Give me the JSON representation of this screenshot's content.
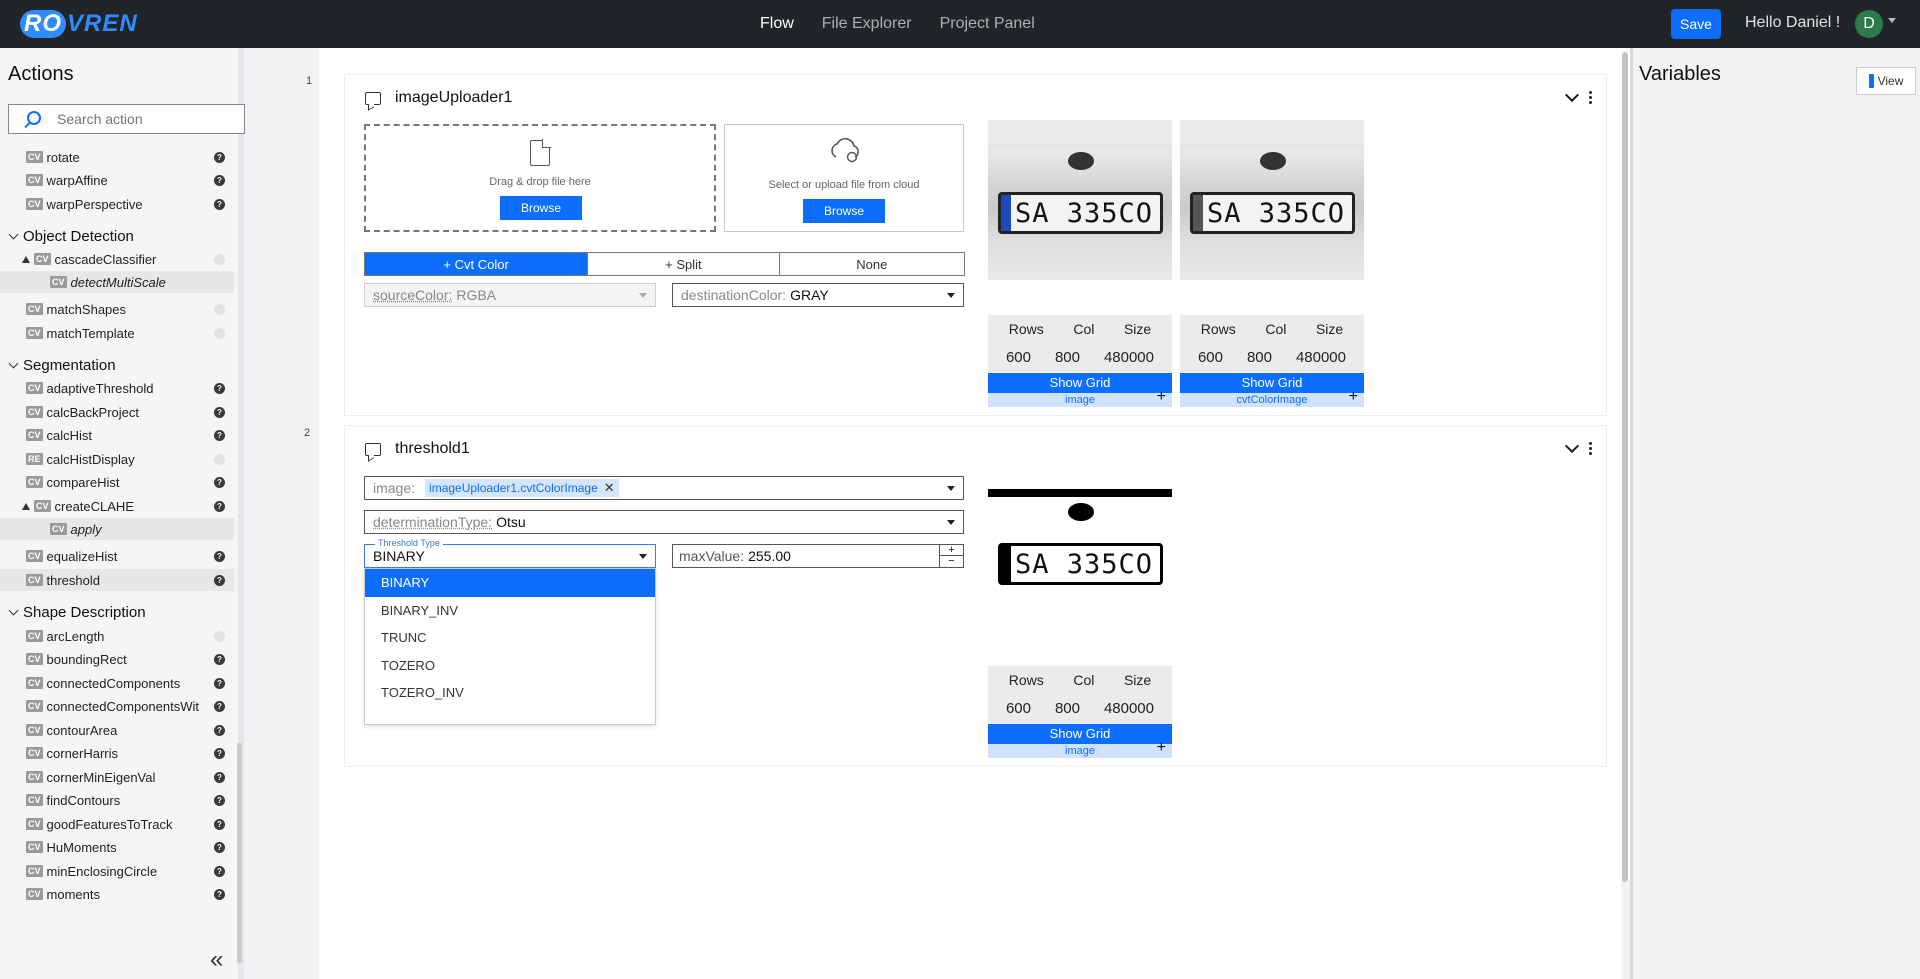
{
  "app": {
    "logo": "ROVREN",
    "logo_ro": "RO",
    "logo_rest": "VREN"
  },
  "nav": {
    "items": [
      "Flow",
      "File Explorer",
      "Project Panel"
    ],
    "active": "Flow"
  },
  "header": {
    "save_label": "Save",
    "greeting": "Hello Daniel !",
    "avatar_initial": "D"
  },
  "sidebar": {
    "title": "Actions",
    "search_placeholder": "Search action",
    "items": [
      {
        "type": "item",
        "tag": "CV",
        "label": "rotate",
        "help": true
      },
      {
        "type": "item",
        "tag": "CV",
        "label": "warpAffine",
        "help": true
      },
      {
        "type": "item",
        "tag": "CV",
        "label": "warpPerspective",
        "help": true
      },
      {
        "type": "group",
        "label": "Object Detection"
      },
      {
        "type": "item",
        "tag": "CV",
        "label": "cascadeClassifier",
        "help": false,
        "expanded": true
      },
      {
        "type": "child",
        "tag": "CV",
        "label": "detectMultiScale"
      },
      {
        "type": "item",
        "tag": "CV",
        "label": "matchShapes",
        "help": false
      },
      {
        "type": "item",
        "tag": "CV",
        "label": "matchTemplate",
        "help": false
      },
      {
        "type": "group",
        "label": "Segmentation"
      },
      {
        "type": "item",
        "tag": "CV",
        "label": "adaptiveThreshold",
        "help": true
      },
      {
        "type": "item",
        "tag": "CV",
        "label": "calcBackProject",
        "help": true
      },
      {
        "type": "item",
        "tag": "CV",
        "label": "calcHist",
        "help": true
      },
      {
        "type": "item",
        "tag": "RE",
        "label": "calcHistDisplay",
        "help": false
      },
      {
        "type": "item",
        "tag": "CV",
        "label": "compareHist",
        "help": true
      },
      {
        "type": "item",
        "tag": "CV",
        "label": "createCLAHE",
        "help": true,
        "expanded": true
      },
      {
        "type": "child",
        "tag": "CV",
        "label": "apply"
      },
      {
        "type": "item",
        "tag": "CV",
        "label": "equalizeHist",
        "help": true
      },
      {
        "type": "item",
        "tag": "CV",
        "label": "threshold",
        "help": true,
        "selected": true
      },
      {
        "type": "group",
        "label": "Shape Description"
      },
      {
        "type": "item",
        "tag": "CV",
        "label": "arcLength",
        "help": false
      },
      {
        "type": "item",
        "tag": "CV",
        "label": "boundingRect",
        "help": true
      },
      {
        "type": "item",
        "tag": "CV",
        "label": "connectedComponents",
        "help": true
      },
      {
        "type": "item",
        "tag": "CV",
        "label": "connectedComponentsWit",
        "help": true
      },
      {
        "type": "item",
        "tag": "CV",
        "label": "contourArea",
        "help": true
      },
      {
        "type": "item",
        "tag": "CV",
        "label": "cornerHarris",
        "help": true
      },
      {
        "type": "item",
        "tag": "CV",
        "label": "cornerMinEigenVal",
        "help": true
      },
      {
        "type": "item",
        "tag": "CV",
        "label": "findContours",
        "help": true
      },
      {
        "type": "item",
        "tag": "CV",
        "label": "goodFeaturesToTrack",
        "help": true
      },
      {
        "type": "item",
        "tag": "CV",
        "label": "HuMoments",
        "help": true
      },
      {
        "type": "item",
        "tag": "CV",
        "label": "minEnclosingCircle",
        "help": true
      },
      {
        "type": "item",
        "tag": "CV",
        "label": "moments",
        "help": true
      }
    ],
    "help_glyph": "?"
  },
  "variables": {
    "title": "Variables",
    "view_label": "View"
  },
  "flow": {
    "line_numbers": [
      "1",
      "2"
    ],
    "node1": {
      "title": "imageUploader1",
      "drop_text": "Drag & drop file here",
      "cloud_text": "Select or upload file from cloud",
      "browse_label": "Browse",
      "segments": [
        "+ Cvt Color",
        "+ Split",
        "None"
      ],
      "active_segment": "+ Cvt Color",
      "source_color_label": "sourceColor:",
      "source_color_value": "RGBA",
      "dest_color_label": "destinationColor:",
      "dest_color_value": "GRAY",
      "images": [
        {
          "name": "image",
          "rows": "600",
          "cols": "800",
          "size": "480000",
          "plate": "SA 335CO"
        },
        {
          "name": "cvtColorImage",
          "rows": "600",
          "cols": "800",
          "size": "480000",
          "plate": "SA 335CO"
        }
      ]
    },
    "node2": {
      "title": "threshold1",
      "image_label": "image:",
      "image_chip": "imageUploader1.cvtColorImage",
      "determination_label": "determinationType:",
      "determination_value": "Otsu",
      "threshold_type_label": "Threshold Type",
      "threshold_type_value": "BINARY",
      "max_value_label": "maxValue:",
      "max_value": "255.00",
      "options": [
        "BINARY",
        "BINARY_INV",
        "TRUNC",
        "TOZERO",
        "TOZERO_INV"
      ],
      "selected_option": "BINARY",
      "images": [
        {
          "name": "image",
          "rows": "600",
          "cols": "800",
          "size": "480000",
          "plate": "SA 335CO"
        }
      ]
    },
    "meta_headers": {
      "rows": "Rows",
      "cols": "Col",
      "size": "Size"
    },
    "show_grid_label": "Show Grid"
  },
  "colors": {
    "accent": "#0d6efd",
    "topbar": "#212529",
    "avatar": "#2f7a4c"
  }
}
